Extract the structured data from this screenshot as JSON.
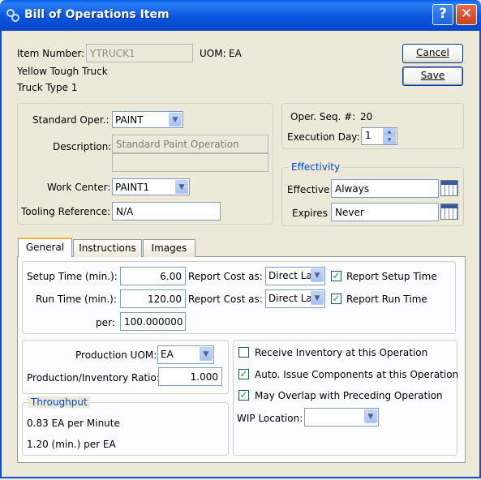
{
  "window": {
    "title": "Bill of Operations Item",
    "help_label": "?",
    "close_label": "✕"
  },
  "header": {
    "item_number_label": "Item Number:",
    "item_number_value": "YTRUCK1",
    "uom_label": "UOM:",
    "uom_value": "EA",
    "description1": "Yellow Tough Truck",
    "description2": "Truck Type 1"
  },
  "buttons": {
    "cancel": "Cancel",
    "save": "Save"
  },
  "operation": {
    "standard_oper_label": "Standard Oper.:",
    "standard_oper_value": "PAINT",
    "description_label": "Description:",
    "description_value": "Standard Paint Operation",
    "description_value2": "",
    "work_center_label": "Work Center:",
    "work_center_value": "PAINT1",
    "tooling_label": "Tooling Reference:",
    "tooling_value": "N/A"
  },
  "sequence": {
    "oper_seq_label": "Oper. Seq. #:",
    "oper_seq_value": "20",
    "execution_day_label": "Execution Day:",
    "execution_day_value": "1"
  },
  "effectivity": {
    "title": "Effectivity",
    "effective_label": "Effective",
    "effective_value": "Always",
    "expires_label": "Expires",
    "expires_value": "Never"
  },
  "tabs": [
    {
      "label": "General",
      "active": true
    },
    {
      "label": "Instructions",
      "active": false
    },
    {
      "label": "Images",
      "active": false
    }
  ],
  "general": {
    "setup_time_label": "Setup Time (min.):",
    "setup_time_value": "6.00",
    "report_cost_label": "Report Cost as:",
    "setup_cost_value": "Direct Lab",
    "report_setup_time_label": "Report Setup Time",
    "run_time_label": "Run Time (min.):",
    "run_time_value": "120.00",
    "run_cost_value": "Direct Lab",
    "report_run_time_label": "Report Run Time",
    "per_label": "per:",
    "per_value": "100.000000"
  },
  "production": {
    "uom_label": "Production UOM:",
    "uom_value": "EA",
    "ratio_label": "Production/Inventory Ratio:",
    "ratio_value": "1.000"
  },
  "throughput": {
    "title": "Throughput",
    "line1": "0.83 EA per Minute",
    "line2": "1.20  (min.) per EA"
  },
  "options": {
    "receive_inventory_label": "Receive Inventory at this Operation",
    "auto_issue_label": "Auto. Issue Components at this Operation",
    "may_overlap_label": "May Overlap with Preceding Operation",
    "wip_location_label": "WIP Location:",
    "wip_location_value": ""
  },
  "checks": {
    "receive_inventory": false,
    "auto_issue": true,
    "may_overlap": true,
    "report_setup_time": true,
    "report_run_time": true
  },
  "colors": {
    "title_bar": "#0b55dd",
    "group_title": "#0046d5",
    "check": "#21a121"
  }
}
